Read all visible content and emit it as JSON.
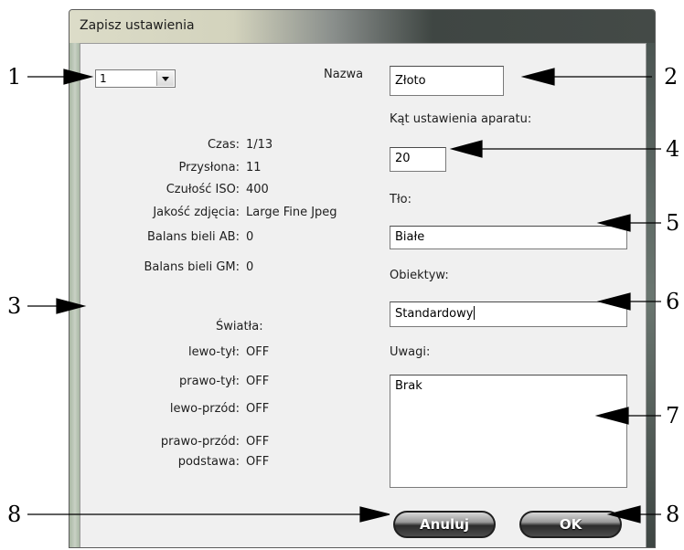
{
  "dialog": {
    "title": "Zapisz ustawienia",
    "preset_select": {
      "value": "1"
    },
    "settings": [
      {
        "label": "Czas:",
        "value": "1/13"
      },
      {
        "label": "Przysłona:",
        "value": "11"
      },
      {
        "label": "Czułość ISO:",
        "value": "400"
      },
      {
        "label": "Jakość zdjęcia:",
        "value": "Large Fine Jpeg"
      },
      {
        "label": "Balans bieli AB:",
        "value": "0"
      },
      {
        "label": "Balans bieli GM:",
        "value": "0"
      }
    ],
    "lights_heading": "Światła:",
    "lights": [
      {
        "label": "lewo-tył:",
        "value": "OFF"
      },
      {
        "label": "prawo-tył:",
        "value": "OFF"
      },
      {
        "label": "lewo-przód:",
        "value": "OFF"
      },
      {
        "label": "prawo-przód:",
        "value": "OFF"
      },
      {
        "label": "podstawa:",
        "value": "OFF"
      }
    ],
    "name_label": "Nazwa",
    "name_value": "Złoto",
    "angle_label": "Kąt ustawienia aparatu:",
    "angle_value": "20",
    "background_label": "Tło:",
    "background_value": "Białe",
    "lens_label": "Obiektyw:",
    "lens_value": "Standardowy",
    "notes_label": "Uwagi:",
    "notes_value": "Brak",
    "cancel_label": "Anuluj",
    "ok_label": "OK"
  },
  "annotations": [
    "1",
    "2",
    "3",
    "4",
    "5",
    "6",
    "7",
    "8",
    "8"
  ]
}
